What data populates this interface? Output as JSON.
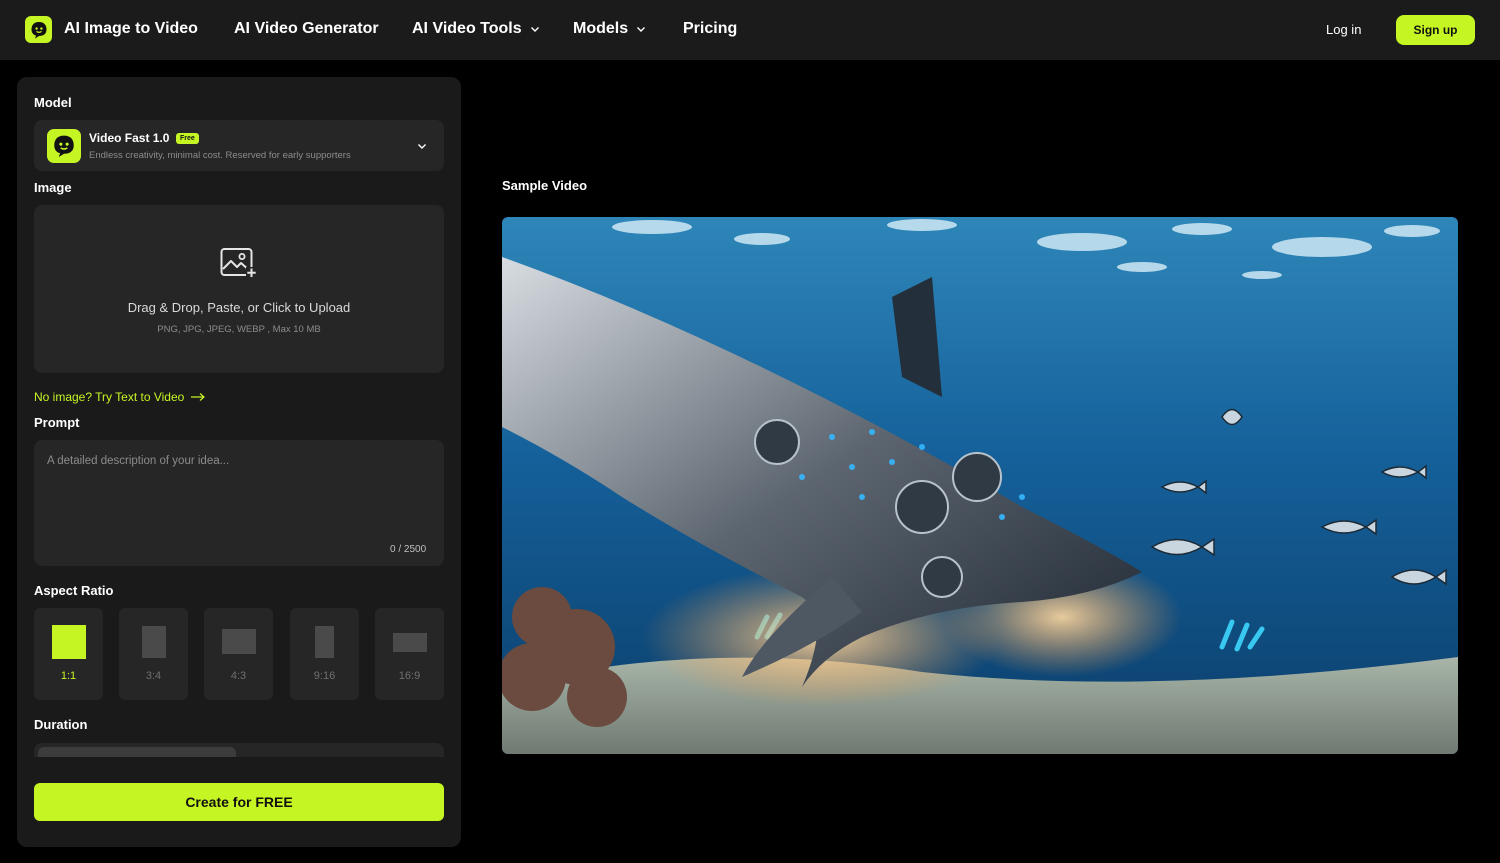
{
  "header": {
    "brand": "AI Image to Video",
    "nav": [
      {
        "label": "AI Video Generator",
        "has_dropdown": false
      },
      {
        "label": "AI Video Tools",
        "has_dropdown": true
      },
      {
        "label": "Models",
        "has_dropdown": true
      },
      {
        "label": "Pricing",
        "has_dropdown": false
      }
    ],
    "login": "Log in",
    "signup": "Sign up"
  },
  "panel": {
    "model": {
      "section": "Model",
      "name": "Video Fast 1.0",
      "badge": "Free",
      "description": "Endless creativity, minimal cost. Reserved for early supporters"
    },
    "image": {
      "section": "Image",
      "upload_text": "Drag & Drop, Paste, or Click to Upload",
      "upload_formats": "PNG, JPG, JPEG, WEBP , Max 10 MB",
      "text_to_video_link": "No image? Try Text to Video"
    },
    "prompt": {
      "section": "Prompt",
      "placeholder": "A detailed description of your idea...",
      "value": "",
      "counter": "0 / 2500"
    },
    "aspect_ratio": {
      "section": "Aspect Ratio",
      "options": [
        "1:1",
        "3:4",
        "4:3",
        "9:16",
        "16:9"
      ],
      "selected": "1:1"
    },
    "duration": {
      "section": "Duration"
    },
    "create_button": "Create for FREE"
  },
  "preview": {
    "title": "Sample Video"
  },
  "colors": {
    "accent": "#c6f524",
    "panel": "#1a1a1a",
    "field": "#262626",
    "header": "#1b1b1b"
  }
}
